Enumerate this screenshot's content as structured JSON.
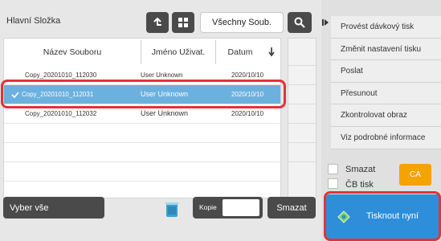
{
  "header": {
    "folder_title": "Hlavní Složka",
    "all_files_label": "Všechny Soub."
  },
  "columns": {
    "file_name": "Název Souboru",
    "user_name": "Jméno Uživat.",
    "date": "Datum"
  },
  "rows": [
    {
      "name": "Copy_20201010_112030",
      "user": "User Unknown",
      "date": "2020/10/10",
      "selected": false
    },
    {
      "name": "Copy_20201010_112031",
      "user": "User Unknown",
      "date": "2020/10/10",
      "selected": true
    },
    {
      "name": "Copy_20201010_112032",
      "user": "User Unknown",
      "date": "2020/10/10",
      "selected": false
    }
  ],
  "bottom": {
    "select_all": "Vyber vše",
    "copies_label": "Kopie",
    "copies_value": "",
    "delete": "Smazat"
  },
  "side_menu": [
    "Provést dávkový tisk",
    "Změnit nastavení tisku",
    "Poslat",
    "Přesunout",
    "Zkontrolovat obraz",
    "Viz podrobné informace"
  ],
  "options": {
    "delete_label": "Smazat",
    "bw_print_label": "ČB tisk",
    "ca_label": "CA"
  },
  "print_now_label": "Tisknout nyní",
  "colors": {
    "selected_row": "#6cb1de",
    "highlight_red": "#e33237",
    "print_button": "#2f8ed9",
    "ca_button": "#f5a300"
  }
}
